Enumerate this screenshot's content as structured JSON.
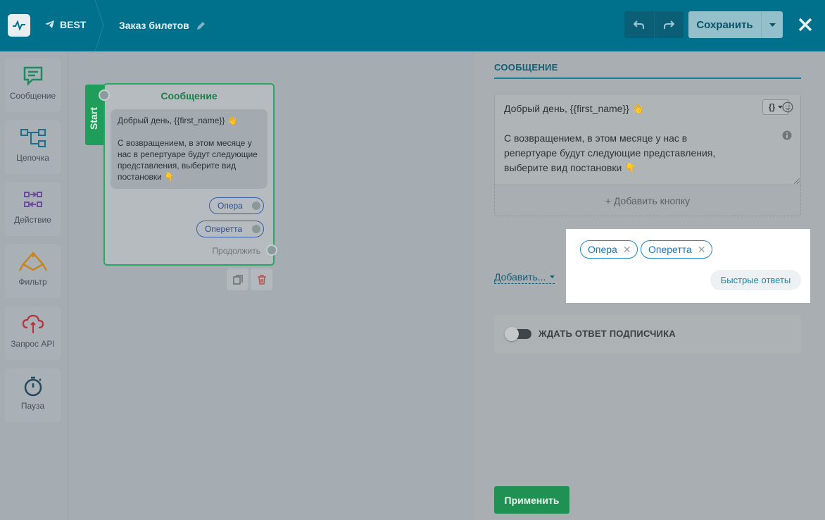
{
  "header": {
    "project": "BEST",
    "flow_name": "Заказ билетов",
    "save_label": "Сохранить"
  },
  "sidebar": {
    "items": [
      {
        "label": "Сообщение",
        "icon": "message-icon"
      },
      {
        "label": "Цепочка",
        "icon": "chain-icon"
      },
      {
        "label": "Действие",
        "icon": "action-icon"
      },
      {
        "label": "Фильтр",
        "icon": "filter-icon"
      },
      {
        "label": "Запрос API",
        "icon": "api-cloud-icon"
      },
      {
        "label": "Пауза",
        "icon": "timer-icon"
      }
    ]
  },
  "node": {
    "start_label": "Start",
    "title": "Сообщение",
    "text": "Добрый день,  {{first_name}} 👋\n\nС возвращением, в этом месяце у нас в репертуаре будут следующие представления, выберите вид постановки 👇",
    "buttons": [
      "Опера",
      "Оперетта"
    ],
    "continue_label": "Продолжить"
  },
  "panel": {
    "tab": "СООБЩЕНИЕ",
    "message_text": "Добрый день,  {{first_name}} 👋\n\nС возвращением, в этом месяце у нас в\nрепертуаре будут следующие представления,\nвыберите вид постановки 👇",
    "var_button": "{}",
    "add_button": "+ Добавить кнопку",
    "add_more": "Добавить...",
    "quick_replies": [
      "Опера",
      "Оперетта"
    ],
    "quick_replies_button": "Быстрые ответы",
    "wait_label": "ЖДАТЬ ОТВЕТ ПОДПИСЧИКА",
    "wait_enabled": false,
    "apply_label": "Применить"
  },
  "colors": {
    "header": "#00718d",
    "accent_green": "#1f9152",
    "link_blue": "#1a72b5"
  }
}
